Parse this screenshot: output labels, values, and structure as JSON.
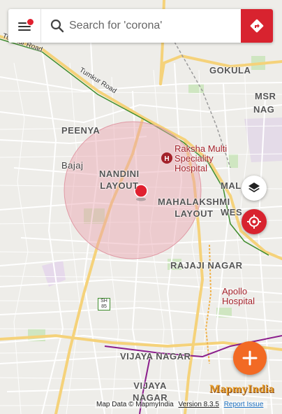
{
  "search": {
    "placeholder": "Search for 'corona'"
  },
  "map_labels": {
    "tumkur_road_1": "Tumkur Road",
    "tumkur_road_2": "Tumkur Road",
    "gokula": "GOKULA",
    "msr_line1": "MSR",
    "msr_line2": "NAG",
    "peenya": "PEENYA",
    "bajaj": "Bajaj",
    "nandini_line1": "NANDINI",
    "nandini_line2": "LAYOUT",
    "mahalakshmi_line1": "MAHALAKSHMI",
    "mahalakshmi_line2": "LAYOUT",
    "malleswaram_partial_1": "MAL",
    "malleswaram_partial_2": "WES",
    "rajaji_nagar": "RAJAJI NAGAR",
    "vijaya_nagar": "VIJAYA NAGAR",
    "vijaya_nagar_2_line1": "VIJAYA",
    "vijaya_nagar_2_line2": "NAGAR",
    "sh85_line1": "SH",
    "sh85_line2": "85"
  },
  "pois": {
    "raksha_line1": "Raksha Multi",
    "raksha_line2": "Speciality",
    "raksha_line3": "Hospital",
    "apollo": "Apollo Hospital"
  },
  "footer": {
    "map_data": "Map Data © MapmyIndia",
    "version": "Version 8.3.5",
    "report": "Report Issue"
  },
  "logo_text": "MapmyIndia",
  "colors": {
    "accent_red": "#d8232f",
    "fab_orange": "#f26a24",
    "circle_fill": "#e8a2ad",
    "road_yellow": "#f5d27a",
    "rail_green": "#3f8d2d",
    "metro_purple": "#8b1d8c"
  }
}
